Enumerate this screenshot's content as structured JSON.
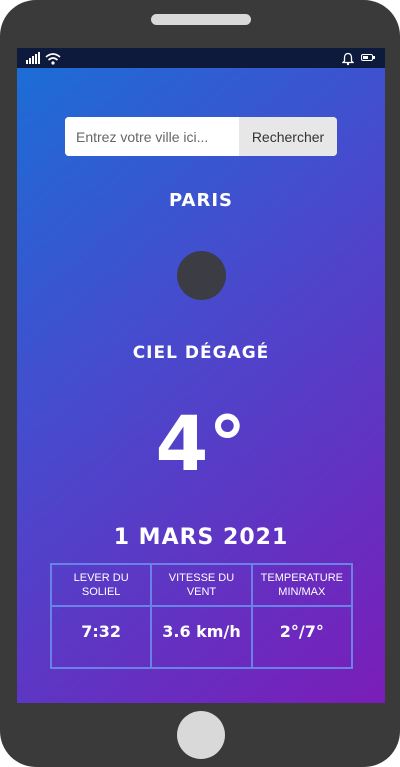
{
  "search": {
    "placeholder": "Entrez votre ville ici...",
    "value": "",
    "button_label": "Rechercher"
  },
  "city": "PARIS",
  "weather": {
    "icon": "weather-icon",
    "description": "CIEL DÉGAGÉ",
    "temperature": "4°"
  },
  "date": "1 MARS 2021",
  "stats": {
    "headers": [
      "LEVER DU SOLIEL",
      "VITESSE DU VENT",
      "TEMPERATURE MIN/MAX"
    ],
    "values": [
      "7:32",
      "3.6 km/h",
      "2°/7°"
    ]
  },
  "colors": {
    "gradient_start": "#1a6fd6",
    "gradient_end": "#7a1db8",
    "status_bar": "#0e1a3c",
    "phone_frame": "#3a3a3a"
  }
}
